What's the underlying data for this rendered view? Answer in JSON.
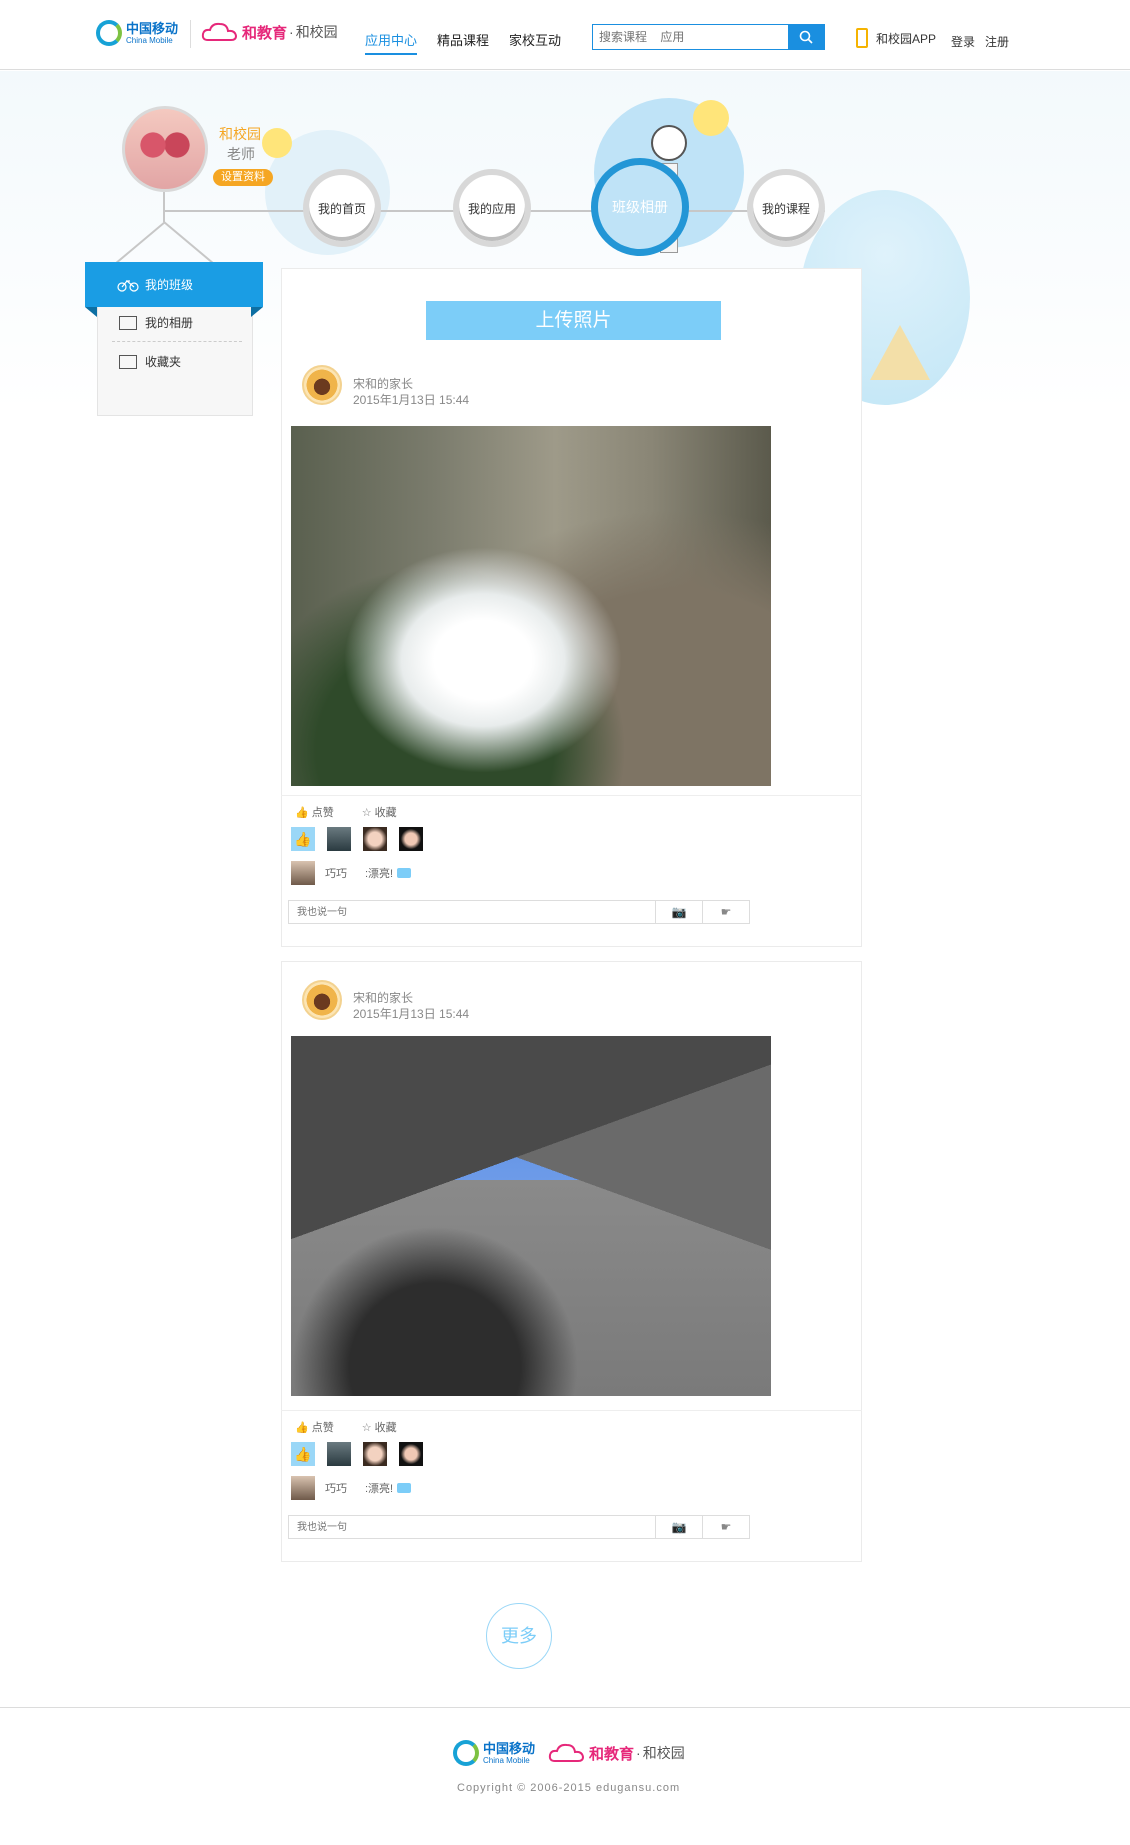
{
  "header": {
    "china_mobile_cn": "中国移动",
    "china_mobile_en": "China Mobile",
    "brand_main": "和教育",
    "brand_sep": "·",
    "brand_sub": "和校园",
    "nav": [
      {
        "label": "应用中心",
        "active": true
      },
      {
        "label": "精品课程",
        "active": false
      },
      {
        "label": "家校互动",
        "active": false
      }
    ],
    "search_placeholder": "搜索课程    应用",
    "app_label": "和校园APP",
    "login": "登录",
    "register": "注册"
  },
  "profile": {
    "name": "和校园",
    "role": "老师",
    "set_profile": "设置资料"
  },
  "circle_nav": [
    {
      "label": "我的首页",
      "active": false
    },
    {
      "label": "我的应用",
      "active": false
    },
    {
      "label": "班级相册",
      "active": true
    },
    {
      "label": "我的课程",
      "active": false
    }
  ],
  "side_menu": [
    {
      "label": "我的班级",
      "active": true
    },
    {
      "label": "我的相册",
      "active": false
    },
    {
      "label": "收藏夹",
      "active": false
    }
  ],
  "upload_label": "上传照片",
  "posts": [
    {
      "author": "宋和的家长",
      "time": "2015年1月13日  15:44",
      "like_label": "点赞",
      "fav_label": "收藏",
      "commenter": "巧巧",
      "comment": ":漂亮!",
      "comment_placeholder": "我也说一句"
    },
    {
      "author": "宋和的家长",
      "time": "2015年1月13日  15:44",
      "like_label": "点赞",
      "fav_label": "收藏",
      "commenter": "巧巧",
      "comment": ":漂亮!",
      "comment_placeholder": "我也说一句"
    }
  ],
  "more_label": "更多",
  "footer": {
    "copyright": "Copyright © 2006-2015   edugansu.com"
  },
  "colors": {
    "accent": "#1a9de4",
    "brand_pink": "#e6287a",
    "orange": "#f5a623",
    "light_blue": "#7ccdf8"
  }
}
